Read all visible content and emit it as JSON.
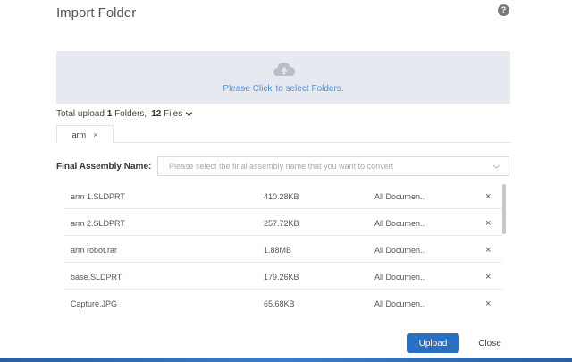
{
  "dialog": {
    "title": "Import Folder",
    "help_icon": "?"
  },
  "dropzone": {
    "icon": "cloud-upload-icon",
    "text_prefix": "Please Click",
    "text_suffix": "to select Folders."
  },
  "summary": {
    "prefix": "Total upload",
    "folder_count": "1",
    "folders_label": "Folders,",
    "file_count": "12",
    "files_label": "Files"
  },
  "tabs": [
    {
      "label": "arm",
      "close": "×"
    }
  ],
  "assembly": {
    "label": "Final Assembly Name:",
    "placeholder": "Please select the final assembly name that you want to convert"
  },
  "files": [
    {
      "name": "arm 1.SLDPRT",
      "size": "410.28KB",
      "type": "All Documen..",
      "remove": "×"
    },
    {
      "name": "arm 2.SLDPRT",
      "size": "257.72KB",
      "type": "All Documen..",
      "remove": "×"
    },
    {
      "name": "arm robot.rar",
      "size": "1.88MB",
      "type": "All Documen..",
      "remove": "×"
    },
    {
      "name": "base.SLDPRT",
      "size": "179.26KB",
      "type": "All Documen..",
      "remove": "×"
    },
    {
      "name": "Capture.JPG",
      "size": "65.68KB",
      "type": "All Documen..",
      "remove": "×"
    }
  ],
  "buttons": {
    "upload": "Upload",
    "close": "Close"
  },
  "colors": {
    "accent": "#2b6fc0",
    "link": "#4a90d9",
    "dropzone_bg": "#e6e9f0"
  }
}
